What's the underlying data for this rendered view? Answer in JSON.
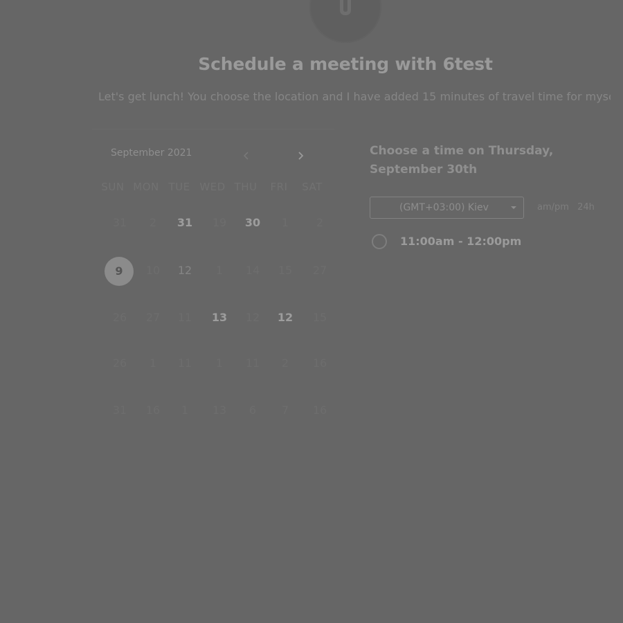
{
  "header": {
    "avatar_icon": "user-logo-icon",
    "title": "Schedule a meeting with 6test",
    "description": "Let's get lunch! You choose the location and I have added 15 minutes of travel time for myself."
  },
  "calendar": {
    "month_label": "September 2021",
    "prev_icon": "chevron-left-icon",
    "next_icon": "chevron-right-icon",
    "weekdays": [
      "SUN",
      "MON",
      "TUE",
      "WED",
      "THU",
      "FRI",
      "SAT"
    ],
    "weeks": [
      [
        {
          "label": "31",
          "state": "dim"
        },
        {
          "label": "2",
          "state": "dim"
        },
        {
          "label": "31",
          "state": "avail"
        },
        {
          "label": "19",
          "state": "dim"
        },
        {
          "label": "30",
          "state": "avail"
        },
        {
          "label": "1",
          "state": "dim"
        },
        {
          "label": "2",
          "state": "dim"
        }
      ],
      [
        {
          "label": "9",
          "state": "selected"
        },
        {
          "label": "10",
          "state": "dim"
        },
        {
          "label": "12",
          "state": "mid"
        },
        {
          "label": "1",
          "state": "dim"
        },
        {
          "label": "14",
          "state": "dim"
        },
        {
          "label": "15",
          "state": "dim"
        },
        {
          "label": "27",
          "state": "dim"
        }
      ],
      [
        {
          "label": "26",
          "state": "dim"
        },
        {
          "label": "27",
          "state": "dim"
        },
        {
          "label": "11",
          "state": "dim"
        },
        {
          "label": "13",
          "state": "avail"
        },
        {
          "label": "12",
          "state": "dim"
        },
        {
          "label": "12",
          "state": "avail"
        },
        {
          "label": "15",
          "state": "dim"
        }
      ],
      [
        {
          "label": "26",
          "state": "dim"
        },
        {
          "label": "1",
          "state": "dim"
        },
        {
          "label": "11",
          "state": "dim"
        },
        {
          "label": "1",
          "state": "dim"
        },
        {
          "label": "11",
          "state": "dim"
        },
        {
          "label": "2",
          "state": "dim"
        },
        {
          "label": "16",
          "state": "dim"
        }
      ],
      [
        {
          "label": "31",
          "state": "dim"
        },
        {
          "label": "16",
          "state": "dim"
        },
        {
          "label": "1",
          "state": "dim"
        },
        {
          "label": "13",
          "state": "dim"
        },
        {
          "label": "6",
          "state": "dim"
        },
        {
          "label": "7",
          "state": "dim"
        },
        {
          "label": "16",
          "state": "dim"
        }
      ]
    ]
  },
  "time_panel": {
    "heading": "Choose a time on Thursday, September 30th",
    "timezone_value": "(GMT+03:00) Kiev",
    "timezone_caret_icon": "caret-down-icon",
    "format_options": [
      "am/pm",
      "24h"
    ],
    "slots": [
      {
        "label": "11:00am - 12:00pm"
      }
    ]
  }
}
